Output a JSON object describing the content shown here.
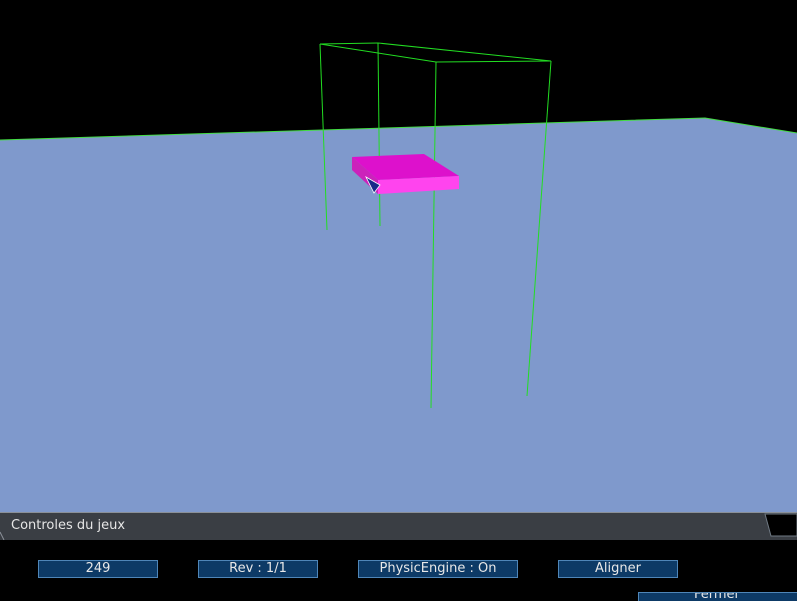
{
  "panel": {
    "title": "Controles du jeux",
    "buttons": {
      "count": "249",
      "revision": "Rev : 1/1",
      "physic_engine": "PhysicEngine : On",
      "align": "Aligner"
    },
    "close_label": "Fermer"
  },
  "colors": {
    "ground": "#7f99cc",
    "wireframe": "#22dd22",
    "object": "#ee22dd",
    "button_bg": "#0d3a66",
    "button_border": "#4f86b8"
  }
}
